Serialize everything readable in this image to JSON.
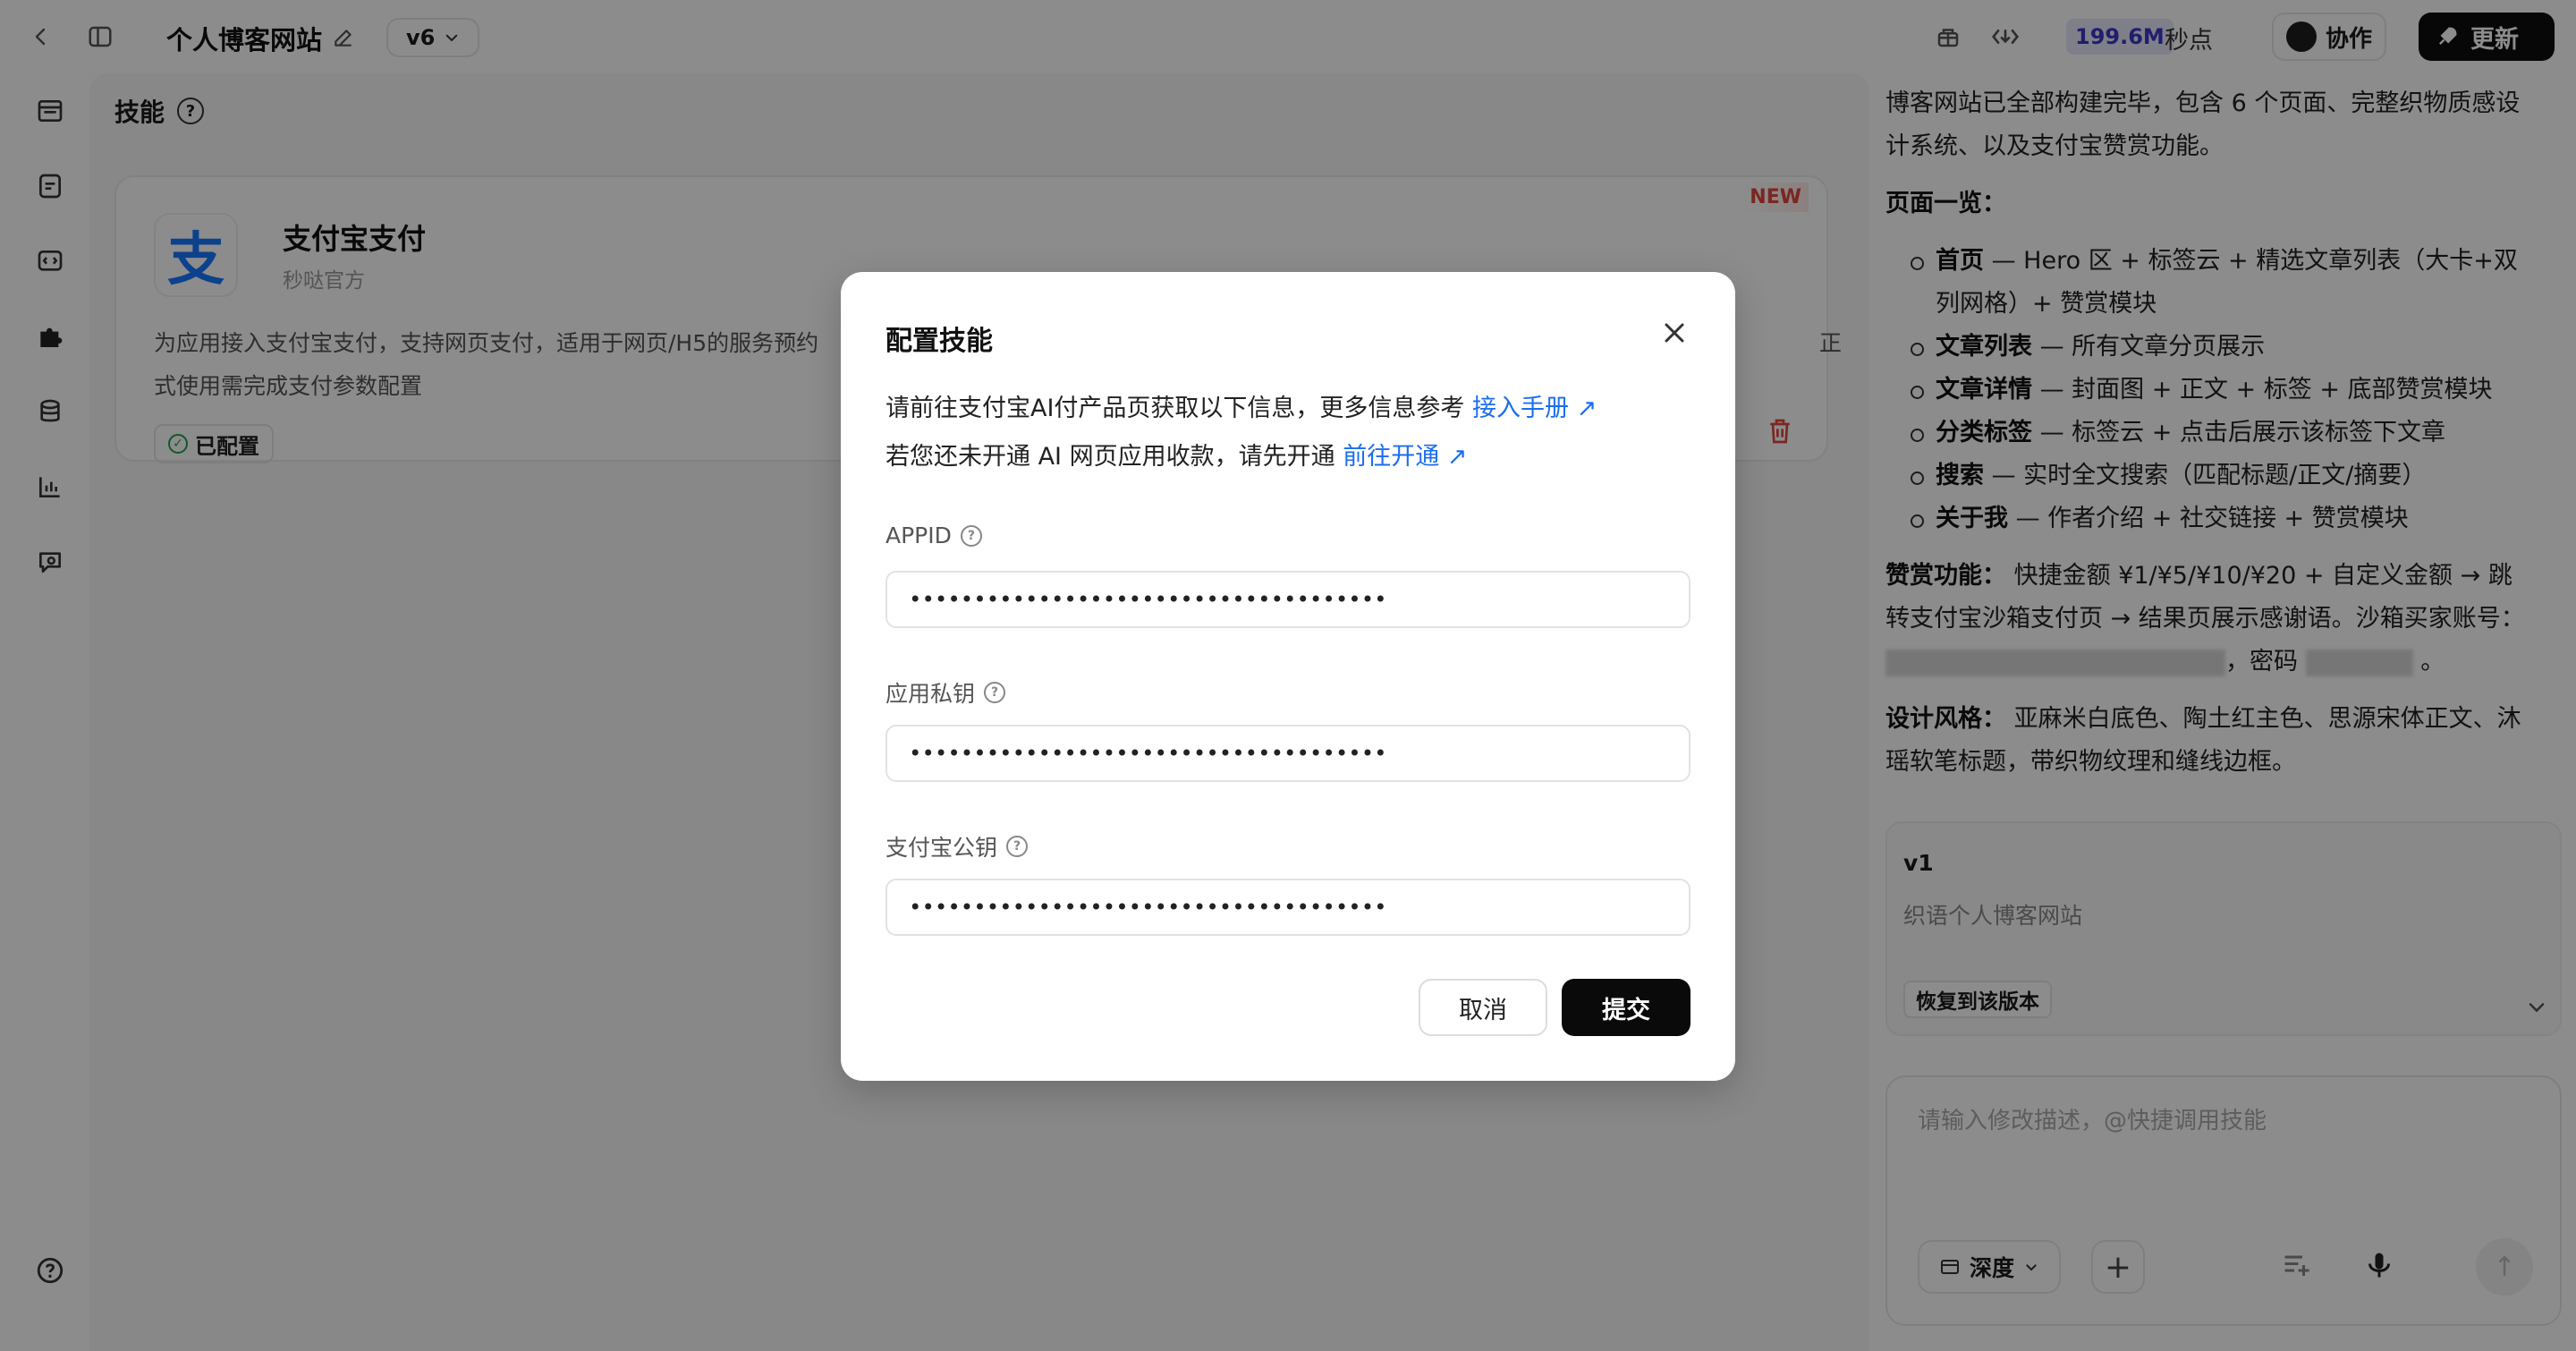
{
  "topbar": {
    "project_title": "个人博客网站",
    "version": "v6",
    "credits": "199.6M",
    "credits_unit": "秒点",
    "collab_label": "协作",
    "update_label": "更新"
  },
  "main": {
    "title": "技能",
    "skill": {
      "new_tag": "NEW",
      "logo_char": "支",
      "name": "支付宝支付",
      "owner": "秒哒官方",
      "desc_line1": "为应用接入支付宝支付，支持网页支付，适用于网页/H5的服务预约",
      "desc_line1_tail": "正",
      "desc_line2": "式使用需完成支付参数配置",
      "status": "已配置"
    }
  },
  "chat": {
    "intro": "博客网站已全部构建完毕，包含 6 个页面、完整织物质感设计系统、以及支付宝赞赏功能。",
    "pages_heading": "页面一览：",
    "pages": [
      {
        "name": "首页",
        "desc": " — Hero 区 + 标签云 + 精选文章列表（大卡+双列网格）+ 赞赏模块"
      },
      {
        "name": "文章列表",
        "desc": " — 所有文章分页展示"
      },
      {
        "name": "文章详情",
        "desc": " — 封面图 + 正文 + 标签 + 底部赞赏模块"
      },
      {
        "name": "分类标签",
        "desc": " — 标签云 + 点击后展示该标签下文章"
      },
      {
        "name": "搜索",
        "desc": " — 实时全文搜索（匹配标题/正文/摘要）"
      },
      {
        "name": "关于我",
        "desc": " — 作者介绍 + 社交链接 + 赞赏模块"
      }
    ],
    "reward_heading": "赞赏功能：",
    "reward_text": "快捷金额 ¥1/¥5/¥10/¥20 + 自定义金额 → 跳转支付宝沙箱支付页 → 结果页展示感谢语。沙箱买家账号：",
    "reward_pwd": "，密码",
    "reward_end": "。",
    "style_heading": "设计风格：",
    "style_text": "亚麻米白底色、陶土红主色、思源宋体正文、沐瑶软笔标题，带织物纹理和缝线边框。",
    "version_card": {
      "name": "v1",
      "desc": "织语个人博客网站",
      "restore_label": "恢复到该版本"
    },
    "input": {
      "placeholder": "请输入修改描述，@快捷调用技能",
      "mode_label": "深度"
    }
  },
  "modal": {
    "title": "配置技能",
    "line1": "请前往支付宝AI付产品页获取以下信息，更多信息参考",
    "line1_link": "接入手册",
    "line2": "若您还未开通 AI 网页应用收款，请先开通",
    "line2_link": "前往开通",
    "fields": [
      {
        "label": "APPID",
        "value": "•••••••••••••••••••••••••••••••••••••"
      },
      {
        "label": "应用私钥",
        "value": "•••••••••••••••••••••••••••••••••••••"
      },
      {
        "label": "支付宝公钥",
        "value": "•••••••••••••••••••••••••••••••••••••"
      }
    ],
    "cancel_label": "取消",
    "submit_label": "提交"
  },
  "colors": {
    "accent_link": "#1a6df0",
    "alipay_blue": "#1677ff",
    "danger": "#e0453c",
    "success": "#21a04a",
    "primary_button": "#0a0a0a"
  }
}
